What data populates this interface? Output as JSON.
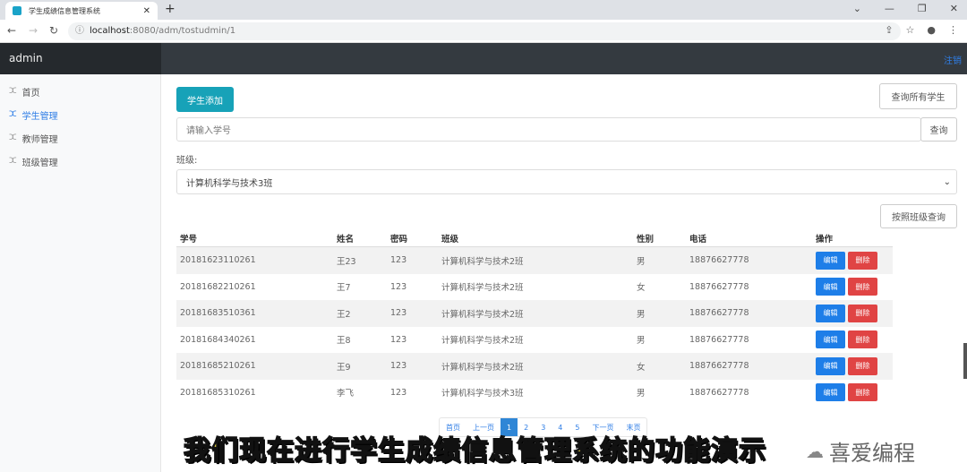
{
  "browser": {
    "tab_title": "学生成绩信息管理系统",
    "url_host": "localhost",
    "url_path": ":8080/adm/tostudmin/1"
  },
  "navbar": {
    "brand": "admin",
    "logout": "注销"
  },
  "sidebar": {
    "items": [
      {
        "label": "首页"
      },
      {
        "label": "学生管理",
        "active": true
      },
      {
        "label": "教师管理"
      },
      {
        "label": "班级管理"
      }
    ]
  },
  "main": {
    "add_button": "学生添加",
    "query_all_button": "查询所有学生",
    "search_placeholder": "请输入学号",
    "search_button": "查询",
    "class_label": "班级:",
    "class_selected": "计算机科学与技术3班",
    "class_query_button": "按照班级查询"
  },
  "table": {
    "headers": [
      "学号",
      "姓名",
      "密码",
      "班级",
      "性别",
      "电话",
      "操作"
    ],
    "rows": [
      [
        "20181623110261",
        "王23",
        "123",
        "计算机科学与技术2班",
        "男",
        "18876627778"
      ],
      [
        "20181682210261",
        "王7",
        "123",
        "计算机科学与技术2班",
        "女",
        "18876627778"
      ],
      [
        "20181683510361",
        "王2",
        "123",
        "计算机科学与技术2班",
        "男",
        "18876627778"
      ],
      [
        "20181684340261",
        "王8",
        "123",
        "计算机科学与技术2班",
        "男",
        "18876627778"
      ],
      [
        "20181685210261",
        "王9",
        "123",
        "计算机科学与技术2班",
        "女",
        "18876627778"
      ],
      [
        "20181685310261",
        "李飞",
        "123",
        "计算机科学与技术3班",
        "男",
        "18876627778"
      ]
    ],
    "edit_label": "编辑",
    "delete_label": "删除"
  },
  "pagination": {
    "items": [
      "首页",
      "上一页",
      "1",
      "2",
      "3",
      "4",
      "5",
      "下一页",
      "末页"
    ],
    "current": "1"
  },
  "overlay": {
    "subtitle": "我们现在进行学生成绩信息管理系统的功能演示",
    "watermark": "喜爱编程"
  }
}
